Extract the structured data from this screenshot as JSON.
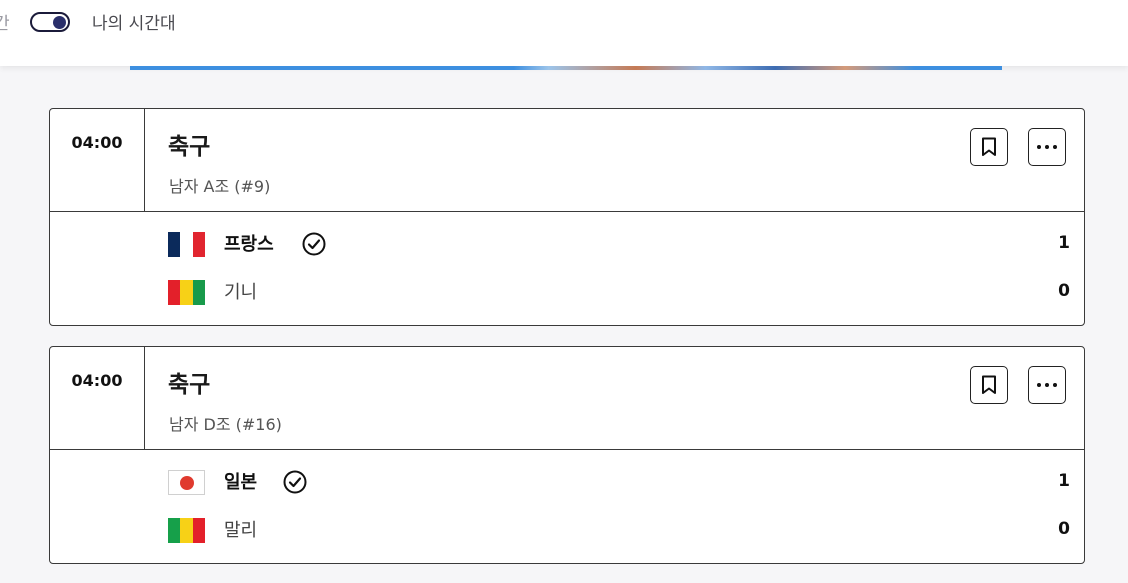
{
  "header": {
    "cut_label": "간",
    "toggle_label": "나의 시간대",
    "toggle_on": true
  },
  "matches": [
    {
      "time": "04:00",
      "sport": "축구",
      "group": "남자 A조 (#9)",
      "teams": [
        {
          "name": "프랑스",
          "score": "1",
          "winner": true,
          "flag": "france-flag"
        },
        {
          "name": "기니",
          "score": "0",
          "winner": false,
          "flag": "guinea-flag"
        }
      ]
    },
    {
      "time": "04:00",
      "sport": "축구",
      "group": "남자 D조 (#16)",
      "teams": [
        {
          "name": "일본",
          "score": "1",
          "winner": true,
          "flag": "japan-flag"
        },
        {
          "name": "말리",
          "score": "0",
          "winner": false,
          "flag": "mali-flag"
        }
      ]
    }
  ],
  "icons": {
    "bookmark": "bookmark-icon",
    "more": "more-options-icon",
    "winner": "check-circle-icon"
  },
  "colors": {
    "toggle_knob": "#2a2f6b",
    "border": "#3a3a3a",
    "background": "#f6f6f8"
  }
}
